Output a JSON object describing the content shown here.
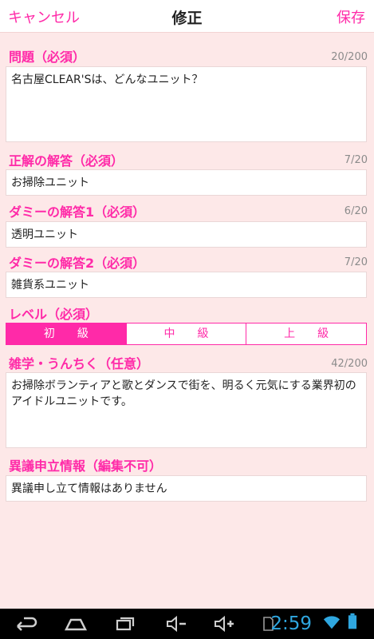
{
  "header": {
    "cancel": "キャンセル",
    "title": "修正",
    "save": "保存"
  },
  "question": {
    "label": "問題（必須）",
    "count": "20/200",
    "value": "名古屋CLEAR'Sは、どんなユニット？"
  },
  "correct": {
    "label": "正解の解答（必須）",
    "count": "7/20",
    "value": "お掃除ユニット"
  },
  "dummy1": {
    "label": "ダミーの解答1（必須）",
    "count": "6/20",
    "value": "透明ユニット"
  },
  "dummy2": {
    "label": "ダミーの解答2（必須）",
    "count": "7/20",
    "value": "雑貨系ユニット"
  },
  "level": {
    "label": "レベル（必須）",
    "options": [
      "初　　級",
      "中　　級",
      "上　　級"
    ],
    "selected": 0
  },
  "trivia": {
    "label": "雑学・うんちく（任意）",
    "count": "42/200",
    "value": "お掃除ボランティアと歌とダンスで街を、明るく元気にする業界初のアイドルユニットです。"
  },
  "objection": {
    "label": "異議申立情報（編集不可）",
    "value": "異議申し立て情報はありません"
  },
  "status": {
    "time": "2:59"
  },
  "colors": {
    "accent": "#ff2aa8",
    "background": "#fde8e8"
  },
  "icons": [
    "back-icon",
    "home-icon",
    "recent-apps-icon",
    "volume-down-icon",
    "volume-up-icon",
    "sd-card-icon",
    "wifi-icon",
    "battery-icon"
  ]
}
